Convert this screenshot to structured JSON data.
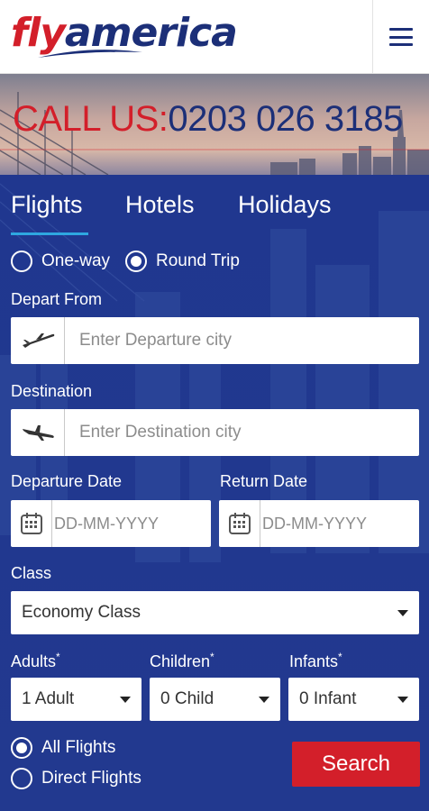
{
  "header": {
    "logo_fly": "fly",
    "logo_america": "america",
    "menu_icon": "hamburger-menu-icon"
  },
  "banner": {
    "call_label": "CALL US:",
    "phone": "0203 026 3185"
  },
  "tabs": [
    {
      "label": "Flights",
      "active": true
    },
    {
      "label": "Hotels",
      "active": false
    },
    {
      "label": "Holidays",
      "active": false
    }
  ],
  "trip_type": {
    "one_way": "One-way",
    "round_trip": "Round Trip",
    "selected": "Round Trip"
  },
  "depart_from": {
    "label": "Depart From",
    "placeholder": "Enter Departure city",
    "icon": "plane-takeoff-icon"
  },
  "destination": {
    "label": "Destination",
    "placeholder": "Enter Destination city",
    "icon": "plane-landing-icon"
  },
  "departure_date": {
    "label": "Departure Date",
    "placeholder": "DD-MM-YYYY",
    "icon": "calendar-icon"
  },
  "return_date": {
    "label": "Return Date",
    "placeholder": "DD-MM-YYYY",
    "icon": "calendar-icon"
  },
  "class": {
    "label": "Class",
    "value": "Economy Class"
  },
  "adults": {
    "label": "Adults",
    "required_mark": "*",
    "value": "1 Adult"
  },
  "children": {
    "label": "Children",
    "required_mark": "*",
    "value": "0 Child"
  },
  "infants": {
    "label": "Infants",
    "required_mark": "*",
    "value": "0 Infant"
  },
  "flight_filter": {
    "all": "All Flights",
    "direct": "Direct Flights",
    "selected": "All Flights"
  },
  "search_button": "Search",
  "colors": {
    "brand_red": "#d31f2a",
    "brand_navy": "#1c2f78",
    "panel_blue": "#20378f",
    "tab_underline": "#2ea7e0"
  }
}
